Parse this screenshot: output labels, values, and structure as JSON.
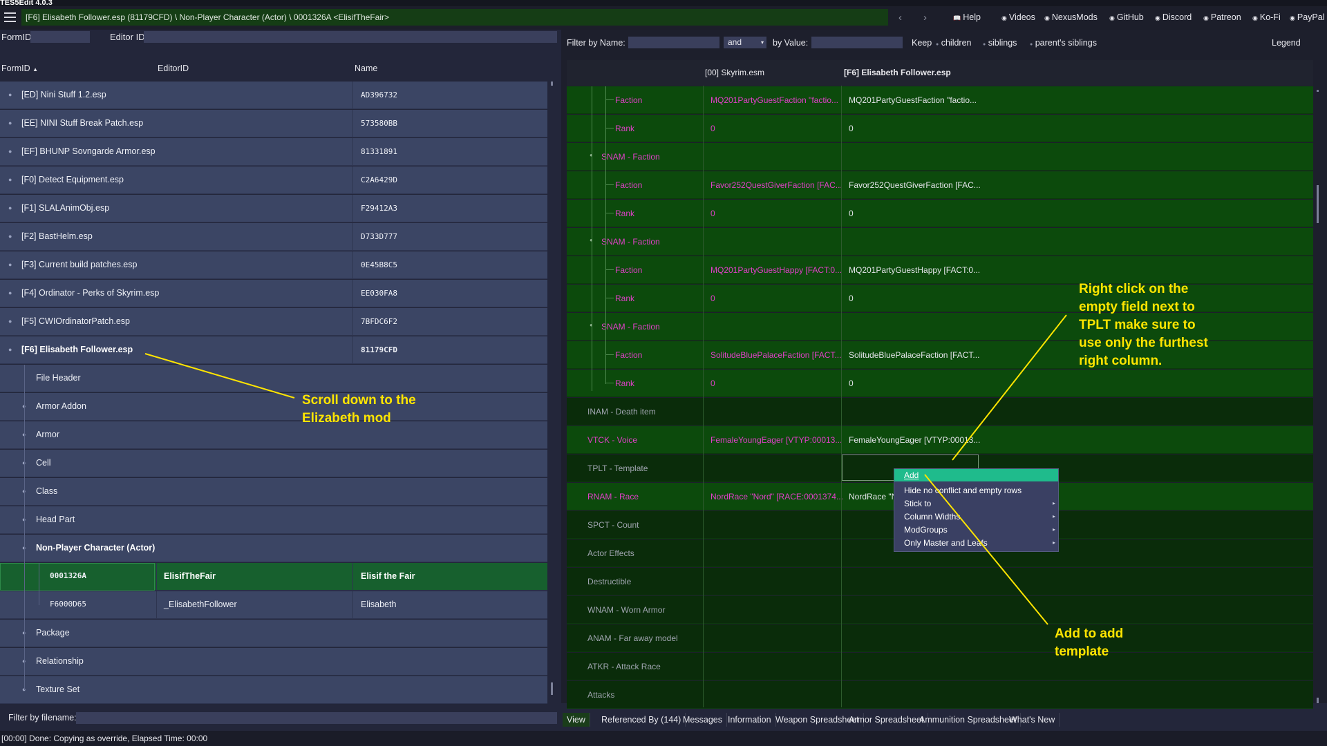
{
  "window": {
    "title": "TES5Edit 4.0.3"
  },
  "top": {
    "path": "[F6] Elisabeth Follower.esp (81179CFD) \\ Non-Player Character (Actor) \\ 0001326A <ElisifTheFair>",
    "links": [
      {
        "label": "Help",
        "icon": "help-icon"
      },
      {
        "label": "Videos",
        "icon": "videos-icon"
      },
      {
        "label": "NexusMods",
        "icon": "nexus-icon"
      },
      {
        "label": "GitHub",
        "icon": "github-icon"
      },
      {
        "label": "Discord",
        "icon": "discord-icon"
      },
      {
        "label": "Patreon",
        "icon": "patreon-icon"
      },
      {
        "label": "Ko-Fi",
        "icon": "kofi-icon"
      },
      {
        "label": "PayPal",
        "icon": "paypal-icon"
      }
    ]
  },
  "left": {
    "formid_label": "FormID",
    "editorid_label": "Editor ID",
    "headers": {
      "formid": "FormID",
      "editorid": "EditorID",
      "name": "Name"
    },
    "rows": [
      {
        "text": "[ED] Nini Stuff 1.2.esp",
        "id": "AD396732"
      },
      {
        "text": "[EE] NINI Stuff Break Patch.esp",
        "id": "573580BB"
      },
      {
        "text": "[EF] BHUNP Sovngarde Armor.esp",
        "id": "81331891"
      },
      {
        "text": "[F0] Detect Equipment.esp",
        "id": "C2A6429D"
      },
      {
        "text": "[F1] SLALAnimObj.esp",
        "id": "F29412A3"
      },
      {
        "text": "[F2] BastHelm.esp",
        "id": "D733D777"
      },
      {
        "text": "[F3] Current build patches.esp",
        "id": "0E45B8C5"
      },
      {
        "text": "[F4] Ordinator - Perks of Skyrim.esp",
        "id": "EE030FA8"
      },
      {
        "text": "[F5] CWIOrdinatorPatch.esp",
        "id": "7BFDC6F2"
      },
      {
        "text": "[F6] Elisabeth Follower.esp",
        "id": "81179CFD"
      },
      {
        "text": "File Header"
      },
      {
        "text": "Armor Addon"
      },
      {
        "text": "Armor"
      },
      {
        "text": "Cell"
      },
      {
        "text": "Class"
      },
      {
        "text": "Head Part"
      },
      {
        "text": "Non-Player Character (Actor)"
      },
      {
        "formid": "0001326A",
        "editorid": "ElisifTheFair",
        "name": "Elisif the Fair"
      },
      {
        "formid": "F6000D65",
        "editorid": "_ElisabethFollower",
        "name": "Elisabeth"
      },
      {
        "text": "Package"
      },
      {
        "text": "Relationship"
      },
      {
        "text": "Texture Set"
      }
    ],
    "filter_label": "Filter by filename:"
  },
  "right": {
    "filter": {
      "name_label": "Filter by Name:",
      "and_value": "and",
      "value_label": "by Value:",
      "keep": "Keep",
      "children": "children",
      "siblings": "siblings",
      "parents_siblings": "parent's siblings",
      "legend": "Legend"
    },
    "headers": {
      "col2": "[00] Skyrim.esm",
      "col3": "[F6] Elisabeth Follower.esp"
    },
    "rows": [
      {
        "label": "Faction",
        "v1": "MQ201PartyGuestFaction \"factio...",
        "v2": "MQ201PartyGuestFaction \"factio..."
      },
      {
        "label": "Rank",
        "v1": "0",
        "v2": "0"
      },
      {
        "label": "SNAM - Faction",
        "v1": "",
        "v2": ""
      },
      {
        "label": "Faction",
        "v1": "Favor252QuestGiverFaction [FAC...",
        "v2": "Favor252QuestGiverFaction [FAC..."
      },
      {
        "label": "Rank",
        "v1": "0",
        "v2": "0"
      },
      {
        "label": "SNAM - Faction",
        "v1": "",
        "v2": ""
      },
      {
        "label": "Faction",
        "v1": "MQ201PartyGuestHappy [FACT:0...",
        "v2": "MQ201PartyGuestHappy [FACT:0..."
      },
      {
        "label": "Rank",
        "v1": "0",
        "v2": "0"
      },
      {
        "label": "SNAM - Faction",
        "v1": "",
        "v2": ""
      },
      {
        "label": "Faction",
        "v1": "SolitudeBluePalaceFaction [FACT...",
        "v2": "SolitudeBluePalaceFaction [FACT..."
      },
      {
        "label": "Rank",
        "v1": "0",
        "v2": "0"
      },
      {
        "label": "INAM - Death item",
        "v1": "",
        "v2": ""
      },
      {
        "label": "VTCK - Voice",
        "v1": "FemaleYoungEager [VTYP:00013...",
        "v2": "FemaleYoungEager [VTYP:00013..."
      },
      {
        "label": "TPLT - Template",
        "v1": "",
        "v2": ""
      },
      {
        "label": "RNAM - Race",
        "v1": "NordRace \"Nord\" [RACE:0001374...",
        "v2": "NordRace \"N"
      },
      {
        "label": "SPCT - Count",
        "v1": "",
        "v2": ""
      },
      {
        "label": "Actor Effects",
        "v1": "",
        "v2": ""
      },
      {
        "label": "Destructible",
        "v1": "",
        "v2": ""
      },
      {
        "label": "WNAM - Worn Armor",
        "v1": "",
        "v2": ""
      },
      {
        "label": "ANAM - Far away model",
        "v1": "",
        "v2": ""
      },
      {
        "label": "ATKR - Attack Race",
        "v1": "",
        "v2": ""
      },
      {
        "label": "Attacks",
        "v1": "",
        "v2": ""
      }
    ],
    "tabs": [
      "View",
      "Referenced By (144)",
      "Messages",
      "Information",
      "Weapon Spreadsheet",
      "Armor Spreadsheet",
      "Ammunition Spreadsheet",
      "What's New"
    ]
  },
  "context_menu": {
    "items": [
      "Add",
      "Hide no conflict and empty rows",
      "Stick to",
      "Column Widths",
      "ModGroups",
      "Only Master and Leafs"
    ]
  },
  "annotations": {
    "scroll": [
      "Scroll down to the",
      "Elizabeth mod"
    ],
    "right_click": [
      "Right click on the",
      "empty field next to",
      "TPLT make sure to",
      "use only the furthest",
      "right column."
    ],
    "add": [
      "Add to add",
      "template"
    ]
  },
  "status": "[00:00] Done: Copying as override, Elapsed Time: 00:00"
}
